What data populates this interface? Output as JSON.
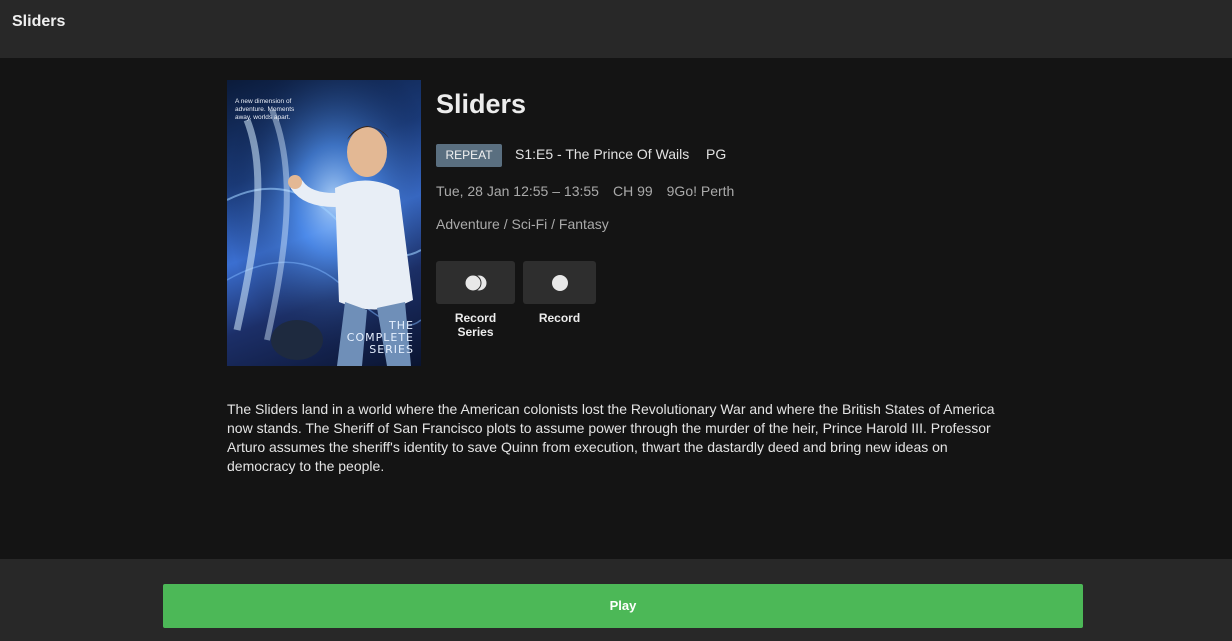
{
  "header": {
    "title": "Sliders"
  },
  "poster": {
    "tagline": "A new dimension of adventure. Moments away. worlds apart.",
    "caption_line1": "THE",
    "caption_line2": "COMPLETE",
    "caption_line3": "SERIES"
  },
  "program": {
    "title": "Sliders",
    "badge": "REPEAT",
    "episode": "S1:E5 - The Prince Of Wails",
    "rating": "PG",
    "date_time": "Tue, 28 Jan 12:55 – 13:55",
    "channel_number": "CH 99",
    "channel_name": "9Go! Perth",
    "genres": "Adventure / Sci-Fi / Fantasy",
    "description": "The Sliders land in a world where the American colonists lost the Revolutionary War and where the British States of America now stands. The Sheriff of San Francisco plots to assume power through the murder of the heir, Prince Harold III. Professor Arturo assumes the sheriff's identity to save Quinn from execution, thwart the dastardly deed and bring new ideas on democracy to the people."
  },
  "actions": {
    "record_series_label": "Record Series",
    "record_label": "Record",
    "record_series_icon": "record-series-icon",
    "record_icon": "record-icon"
  },
  "footer": {
    "play_label": "Play"
  },
  "colors": {
    "play_button": "#4cb857",
    "badge": "#5a6f80",
    "background": "#141414",
    "bar": "#282828"
  }
}
